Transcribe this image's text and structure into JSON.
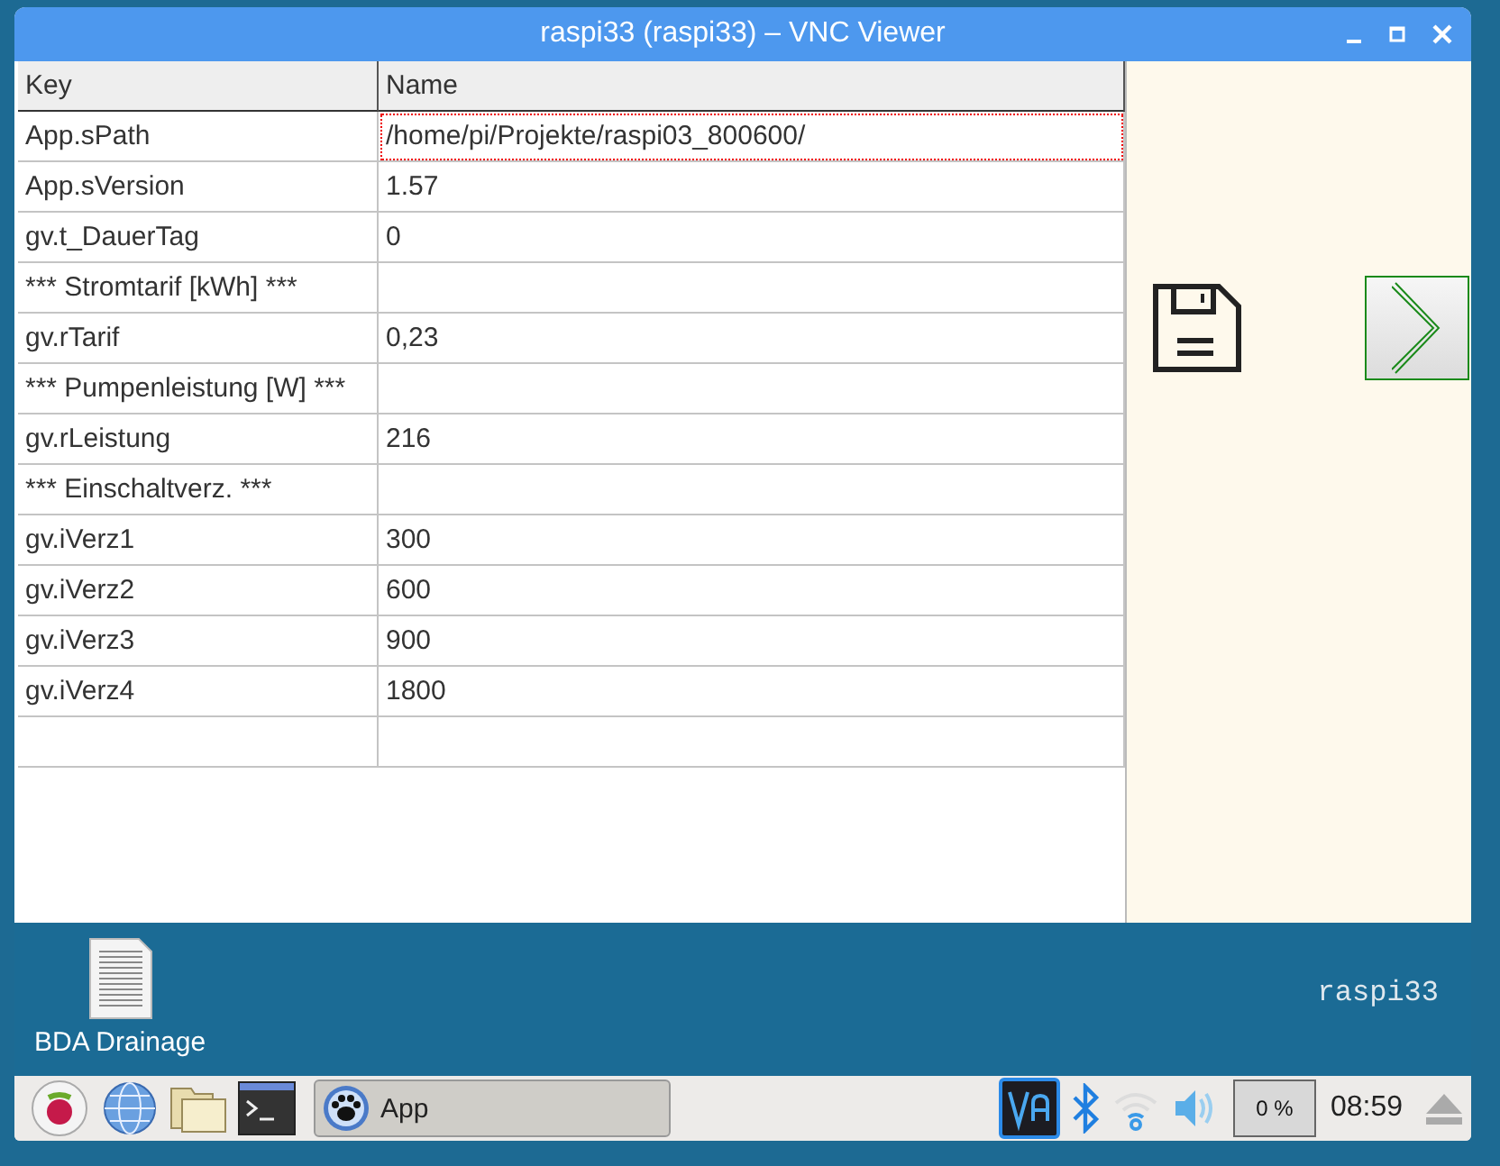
{
  "window": {
    "title": "raspi33 (raspi33) – VNC Viewer"
  },
  "table": {
    "columns": [
      "Key",
      "Name"
    ],
    "rows": [
      {
        "key": "App.sPath",
        "name": "/home/pi/Projekte/raspi03_800600/",
        "focused": true
      },
      {
        "key": "App.sVersion",
        "name": "1.57",
        "focused": false
      },
      {
        "key": "gv.t_DauerTag",
        "name": "0",
        "focused": false
      },
      {
        "key": "*** Stromtarif [kWh] ***",
        "focused": false
      },
      {
        "key": "gv.rTarif",
        "name": "0,23",
        "focused": false
      },
      {
        "key": "*** Pumpenleistung [W] ***",
        "focused": false
      },
      {
        "key": "gv.rLeistung",
        "name": "216",
        "focused": false
      },
      {
        "key": "*** Einschaltverz. ***",
        "focused": false
      },
      {
        "key": "gv.iVerz1",
        "name": "300",
        "focused": false
      },
      {
        "key": "gv.iVerz2",
        "name": "600",
        "focused": false
      },
      {
        "key": "gv.iVerz3",
        "name": "900",
        "focused": false
      },
      {
        "key": "gv.iVerz4",
        "name": "1800",
        "focused": false
      }
    ]
  },
  "desktop": {
    "icons": [
      {
        "label": "BDA Drainage"
      }
    ],
    "hostname": "raspi33"
  },
  "taskbar": {
    "window_buttons": [
      {
        "label": "App"
      }
    ],
    "cpu": "0 %",
    "clock": "08:59"
  }
}
